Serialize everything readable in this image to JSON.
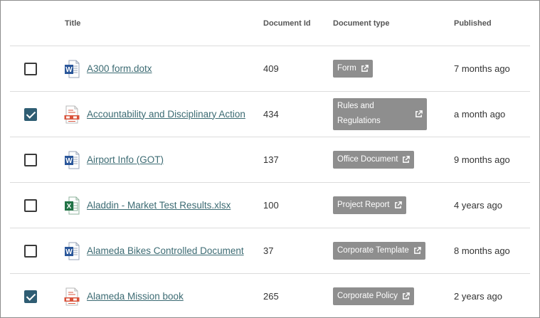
{
  "header": {
    "title": "Title",
    "document_id": "Document Id",
    "document_type": "Document type",
    "published": "Published"
  },
  "rows": [
    {
      "checked": false,
      "file_icon": "word-document-icon",
      "title": "A300 form.dotx",
      "id": "409",
      "type": "Form",
      "published": "7 months ago"
    },
    {
      "checked": true,
      "file_icon": "pdf-document-icon",
      "title": "Accountability and Disciplinary Action",
      "id": "434",
      "type": "Rules and Regulations",
      "published": "a month ago"
    },
    {
      "checked": false,
      "file_icon": "word-document-icon",
      "title": "Airport Info (GOT)",
      "id": "137",
      "type": "Office Document",
      "published": "9 months ago"
    },
    {
      "checked": false,
      "file_icon": "excel-spreadsheet-icon",
      "title": "Aladdin - Market Test Results.xlsx",
      "id": "100",
      "type": "Project Report",
      "published": "4 years ago"
    },
    {
      "checked": false,
      "file_icon": "word-document-icon",
      "title": "Alameda Bikes Controlled Document",
      "id": "37",
      "type": "Corporate Template",
      "published": "8 months ago"
    },
    {
      "checked": true,
      "file_icon": "pdf-document-icon",
      "title": "Alameda Mission book",
      "id": "265",
      "type": "Corporate Policy",
      "published": "2 years ago"
    }
  ],
  "colors": {
    "link": "#3c6b73",
    "tag_bg": "#8e8e8e",
    "checkbox_checked": "#2f5d73",
    "word_blue": "#2b579a",
    "excel_green": "#217346",
    "pdf_red": "#d9533b"
  }
}
